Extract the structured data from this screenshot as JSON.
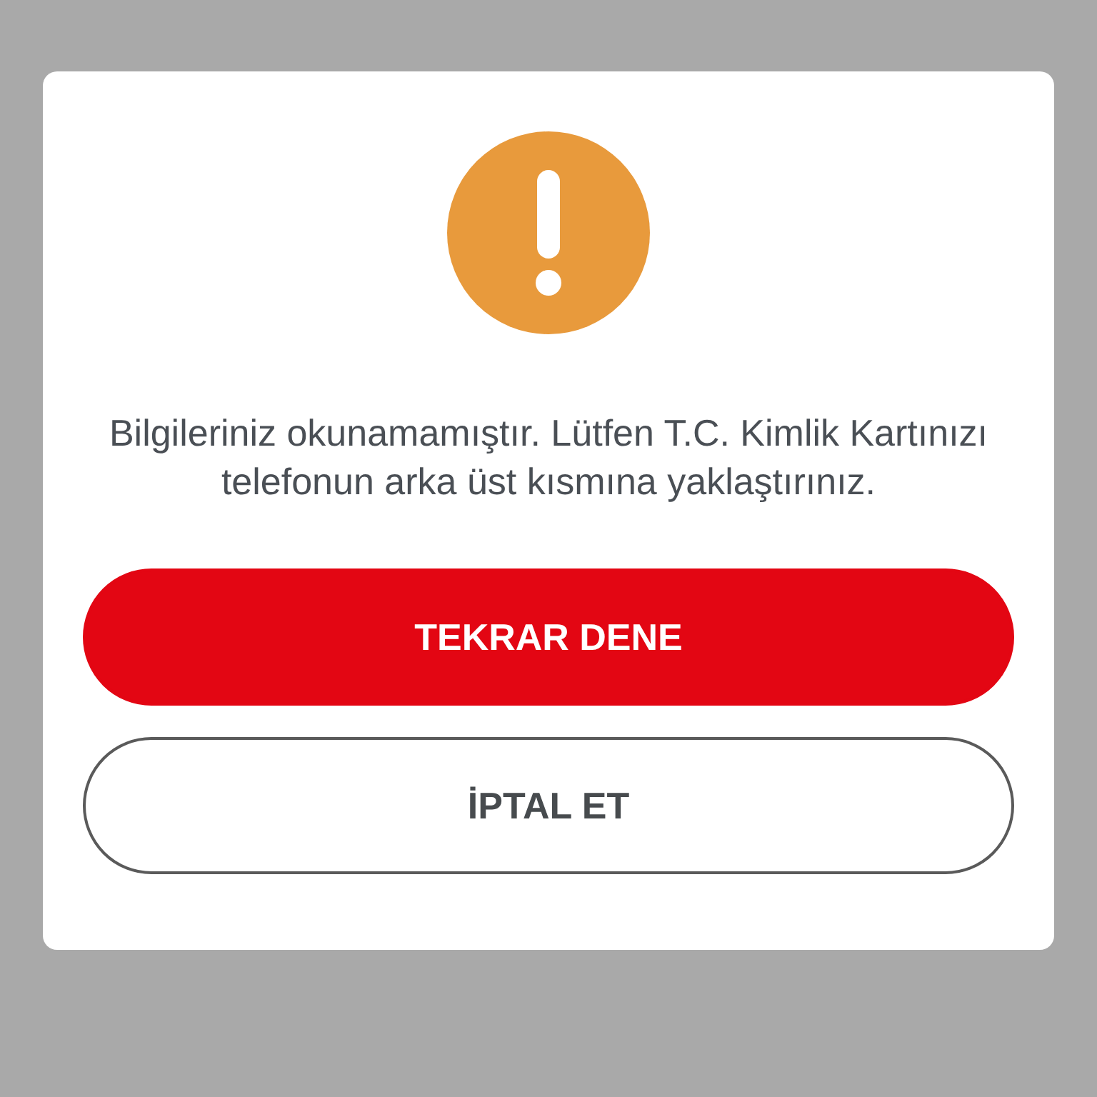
{
  "dialog": {
    "message": "Bilgileriniz okunamamıştır. Lütfen T.C. Kimlik Kartınızı telefonun arka üst kısmına yaklaştırınız.",
    "buttons": [
      {
        "label": "TEKRAR DENE",
        "kind": "primary"
      },
      {
        "label": "İPTAL ET",
        "kind": "secondary"
      }
    ]
  }
}
